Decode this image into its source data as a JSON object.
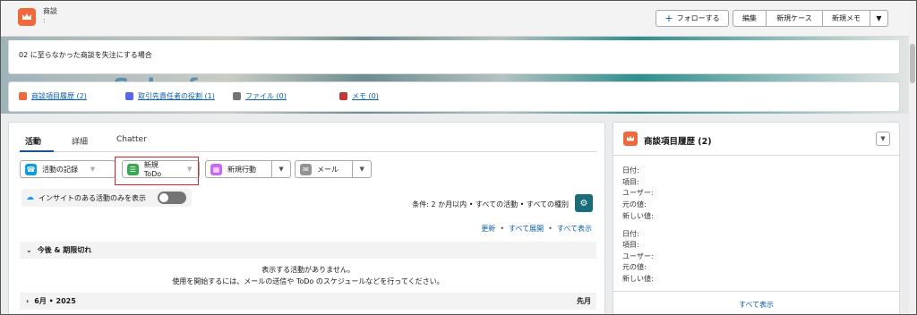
{
  "header": {
    "object_label": "商談",
    "object_sub": ":",
    "follow_label": "フォローする",
    "edit_label": "編集",
    "new_case_label": "新規ケース",
    "new_memo_label": "新規メモ"
  },
  "banner": {
    "text": "Salesforce"
  },
  "info": {
    "text": "02 に至らなかった商談を失注にする場合"
  },
  "related_links": [
    {
      "label": "商談項目履歴 (2)",
      "color": "#f0683d",
      "icon": "crown-icon"
    },
    {
      "label": "取引先責任者の役割 (1)",
      "color": "#5867e8",
      "icon": "contact-role-icon"
    },
    {
      "label": "ファイル (0)",
      "color": "#747474",
      "icon": "file-icon"
    },
    {
      "label": "メモ (0)",
      "color": "#c23934",
      "icon": "note-icon"
    }
  ],
  "activity": {
    "tabs": [
      "活動",
      "詳細",
      "Chatter"
    ],
    "buttons": [
      {
        "label": "活動の記録",
        "color": "#0d9dda",
        "icon": "call-log-icon"
      },
      {
        "label": "新規ToDo",
        "color": "#3ba755",
        "icon": "task-icon"
      },
      {
        "label": "新規行動",
        "color": "#cb65ff",
        "icon": "calendar-icon"
      },
      {
        "label": "メール",
        "color": "#939393",
        "icon": "email-icon"
      }
    ],
    "insight_label": "インサイトのある活動のみを表示",
    "filter_text": "条件: 2 か月以内 • すべての活動 • すべての種別",
    "actions": [
      "更新",
      "すべて展開",
      "すべて表示"
    ],
    "upcoming_section": "今後 & 期限切れ",
    "empty_line1": "表示する活動がありません。",
    "empty_line2": "使用を開始するには、メールの送信や ToDo のスケジュールなどを行ってください。",
    "month_section": "6月 • 2025",
    "month_right": "先月"
  },
  "history": {
    "title": "商談項目履歴 (2)",
    "fields": [
      "日付:",
      "項目:",
      "ユーザー:",
      "元の値:",
      "新しい値:"
    ],
    "show_all": "すべて表示"
  }
}
